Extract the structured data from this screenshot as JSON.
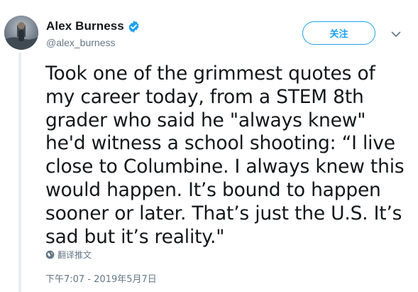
{
  "author": {
    "display_name": "Alex Burness",
    "handle": "@alex_burness",
    "verified": true,
    "avatar_icon": "avatar-photo"
  },
  "actions": {
    "follow_label": "关注",
    "more_icon": "chevron-down-icon"
  },
  "tweet": {
    "text": "Took one of the grimmest quotes of my career today, from a STEM 8th grader who said he \"always knew\" he'd witness a school shooting: “I live close to Columbine. I always knew this would happen. It’s bound to happen sooner or later. That’s just the U.S. It’s sad but it’s reality.\"",
    "translate_label": "翻译推文",
    "timestamp": "下午7:07 - 2019年5月7日"
  },
  "colors": {
    "accent": "#1da1f2",
    "text_primary": "#14171a",
    "text_secondary": "#657786",
    "thread_line": "#e6ecf0"
  }
}
